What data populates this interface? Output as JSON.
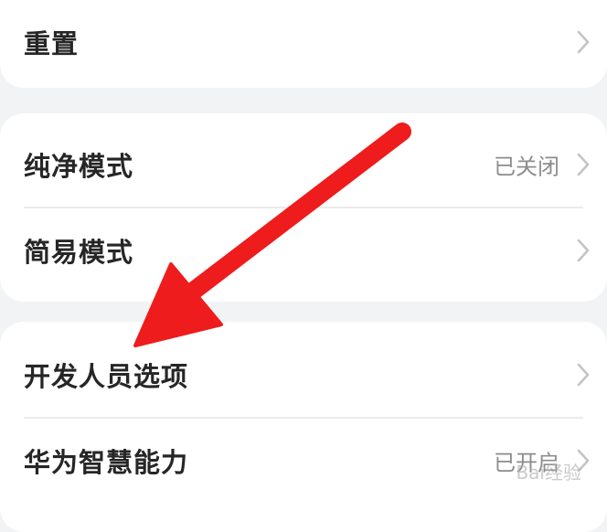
{
  "settings": {
    "group1": [
      {
        "label": "重置",
        "value": ""
      }
    ],
    "group2": [
      {
        "label": "纯净模式",
        "value": "已关闭"
      },
      {
        "label": "简易模式",
        "value": ""
      }
    ],
    "group3": [
      {
        "label": "开发人员选项",
        "value": ""
      },
      {
        "label": "华为智慧能力",
        "value": "已开启"
      }
    ]
  },
  "annotation": {
    "arrow_color": "#ee1c1c",
    "target": "开发人员选项"
  },
  "watermark_text": "Bai经验"
}
